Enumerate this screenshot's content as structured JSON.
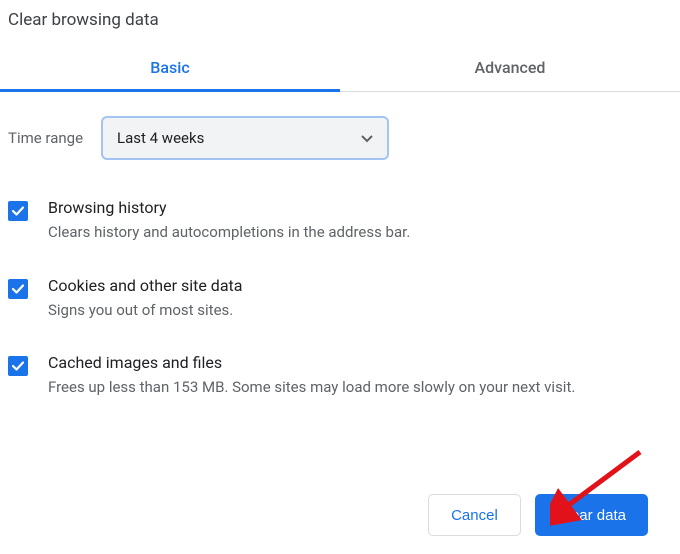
{
  "title": "Clear browsing data",
  "tabs": {
    "basic": "Basic",
    "advanced": "Advanced"
  },
  "time_range": {
    "label": "Time range",
    "selected": "Last 4 weeks"
  },
  "options": [
    {
      "title": "Browsing history",
      "desc": "Clears history and autocompletions in the address bar."
    },
    {
      "title": "Cookies and other site data",
      "desc": "Signs you out of most sites."
    },
    {
      "title": "Cached images and files",
      "desc": "Frees up less than 153 MB. Some sites may load more slowly on your next visit."
    }
  ],
  "buttons": {
    "cancel": "Cancel",
    "clear": "Clear data"
  }
}
